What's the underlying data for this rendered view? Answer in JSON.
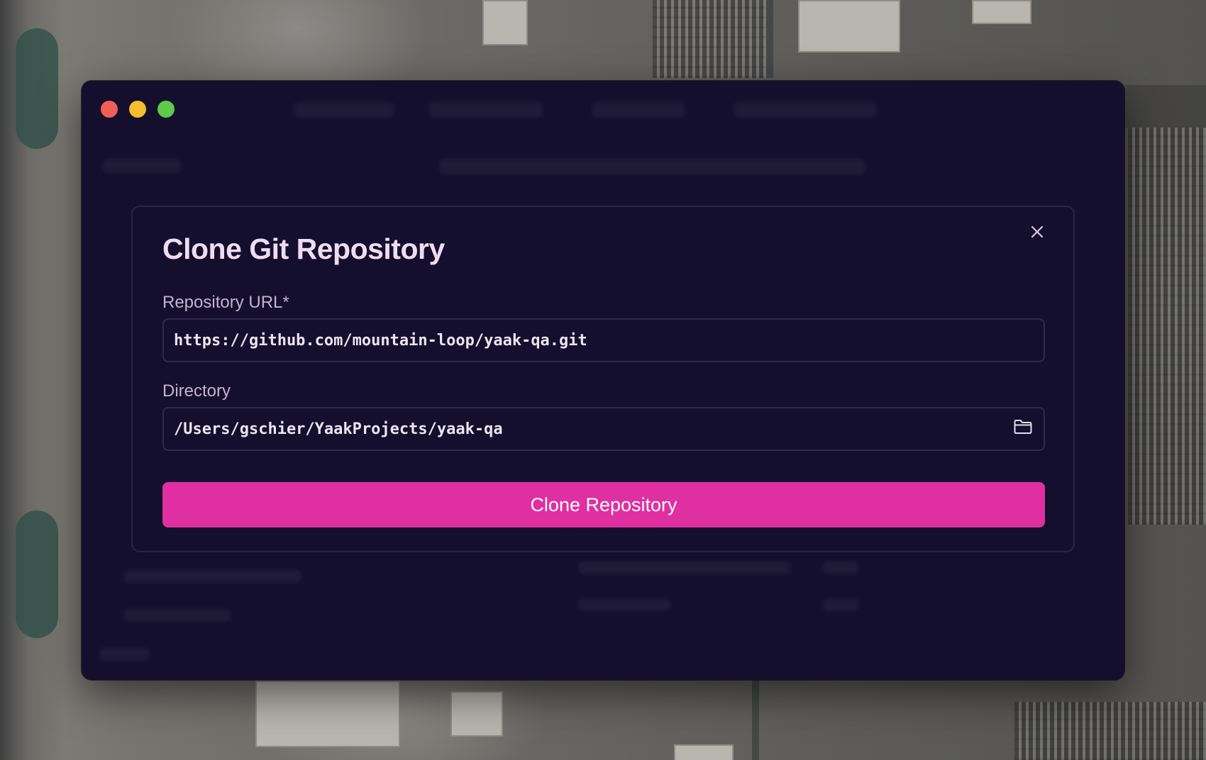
{
  "window": {
    "controls": [
      "close",
      "minimize",
      "maximize"
    ]
  },
  "dialog": {
    "title": "Clone Git Repository",
    "close_icon": "close-icon",
    "repository_url": {
      "label": "Repository URL*",
      "value": "https://github.com/mountain-loop/yaak-qa.git"
    },
    "directory": {
      "label": "Directory",
      "value": "/Users/gschier/YaakProjects/yaak-qa",
      "browse_icon": "folder-icon"
    },
    "submit_label": "Clone Repository"
  },
  "colors": {
    "window_bg": "#130f2d",
    "accent": "#e02fa1",
    "title": "#f0dcf2",
    "label": "#c6b2cf"
  }
}
